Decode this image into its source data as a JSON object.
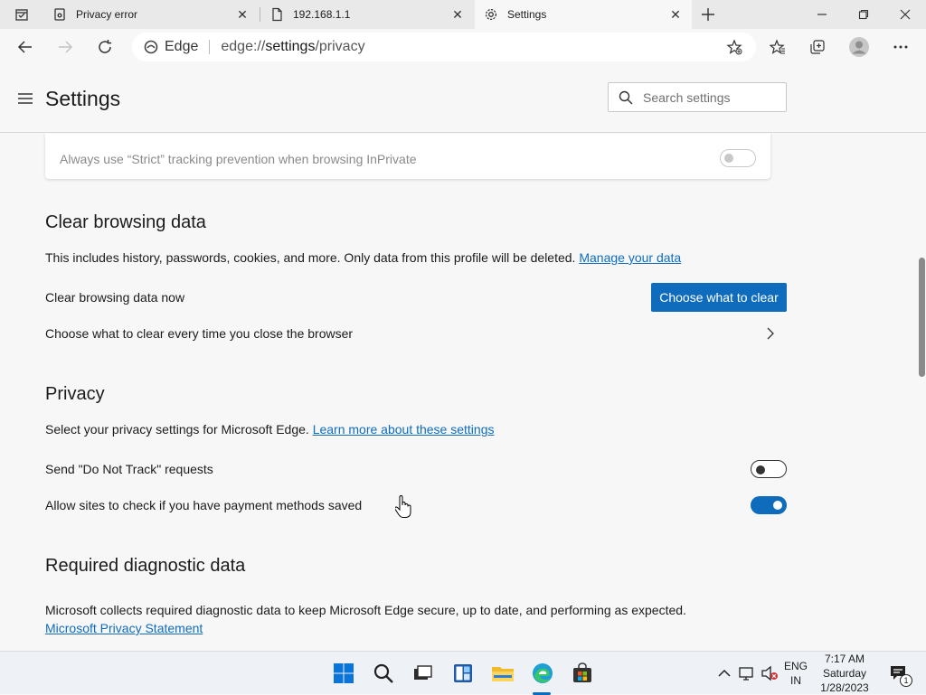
{
  "tabs": [
    {
      "label": "Privacy error",
      "icon": "privacy-error-icon",
      "active": false
    },
    {
      "label": "192.168.1.1",
      "icon": "page-icon",
      "active": false
    },
    {
      "label": "Settings",
      "icon": "gear-icon",
      "active": true
    }
  ],
  "toolbar": {
    "address_brand": "Edge",
    "address_prefix": "edge://",
    "address_host": "settings",
    "address_path": "/privacy"
  },
  "header": {
    "title": "Settings",
    "search_placeholder": "Search settings"
  },
  "tracking": {
    "strict_inprivate_label": "Always use “Strict” tracking prevention when browsing InPrivate",
    "strict_inprivate_enabled": false
  },
  "clear_browsing": {
    "title": "Clear browsing data",
    "description": "This includes history, passwords, cookies, and more. Only data from this profile will be deleted.",
    "manage_link": "Manage your data",
    "now_label": "Clear browsing data now",
    "choose_button": "Choose what to clear",
    "on_close_label": "Choose what to clear every time you close the browser"
  },
  "privacy": {
    "title": "Privacy",
    "description": "Select your privacy settings for Microsoft Edge.",
    "learn_more_link": "Learn more about these settings",
    "dnt_label": "Send \"Do Not Track\" requests",
    "dnt_enabled": false,
    "payment_label": "Allow sites to check if you have payment methods saved",
    "payment_enabled": true
  },
  "diagnostic": {
    "title": "Required diagnostic data",
    "description": "Microsoft collects required diagnostic data to keep Microsoft Edge secure, up to date, and performing as expected.",
    "privacy_statement_link": "Microsoft Privacy Statement"
  },
  "taskbar": {
    "language_line1": "ENG",
    "language_line2": "IN",
    "time": "7:17 AM",
    "day": "Saturday",
    "date": "1/28/2023",
    "notification_count": "1"
  },
  "colors": {
    "accent": "#0f6cbd",
    "background": "#f7f7f7"
  }
}
